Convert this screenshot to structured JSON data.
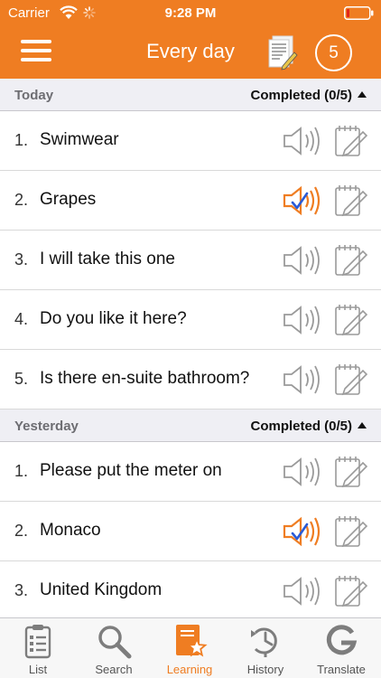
{
  "status_bar": {
    "carrier": "Carrier",
    "time": "9:28 PM"
  },
  "nav": {
    "title": "Every day",
    "count": "5"
  },
  "sections": [
    {
      "title": "Today",
      "status": "Completed (0/5)",
      "items": [
        {
          "num": "1.",
          "text": "Swimwear",
          "audio_played": false
        },
        {
          "num": "2.",
          "text": "Grapes",
          "audio_played": true
        },
        {
          "num": "3.",
          "text": "I will take this one",
          "audio_played": false
        },
        {
          "num": "4.",
          "text": "Do you like it here?",
          "audio_played": false
        },
        {
          "num": "5.",
          "text": "Is there en-suite bathroom?",
          "audio_played": false
        }
      ]
    },
    {
      "title": "Yesterday",
      "status": "Completed (0/5)",
      "items": [
        {
          "num": "1.",
          "text": "Please put the meter on",
          "audio_played": false
        },
        {
          "num": "2.",
          "text": "Monaco",
          "audio_played": true
        },
        {
          "num": "3.",
          "text": "United Kingdom",
          "audio_played": false
        }
      ]
    }
  ],
  "tabs": [
    {
      "label": "List",
      "icon": "clipboard-list-icon",
      "active": false
    },
    {
      "label": "Search",
      "icon": "magnifier-icon",
      "active": false
    },
    {
      "label": "Learning",
      "icon": "book-star-icon",
      "active": true
    },
    {
      "label": "History",
      "icon": "clock-history-icon",
      "active": false
    },
    {
      "label": "Translate",
      "icon": "google-g-icon",
      "active": false
    }
  ],
  "colors": {
    "accent": "#ef7d22",
    "checkmark": "#2a5bd7",
    "icon_gray": "#9a9a9a"
  }
}
